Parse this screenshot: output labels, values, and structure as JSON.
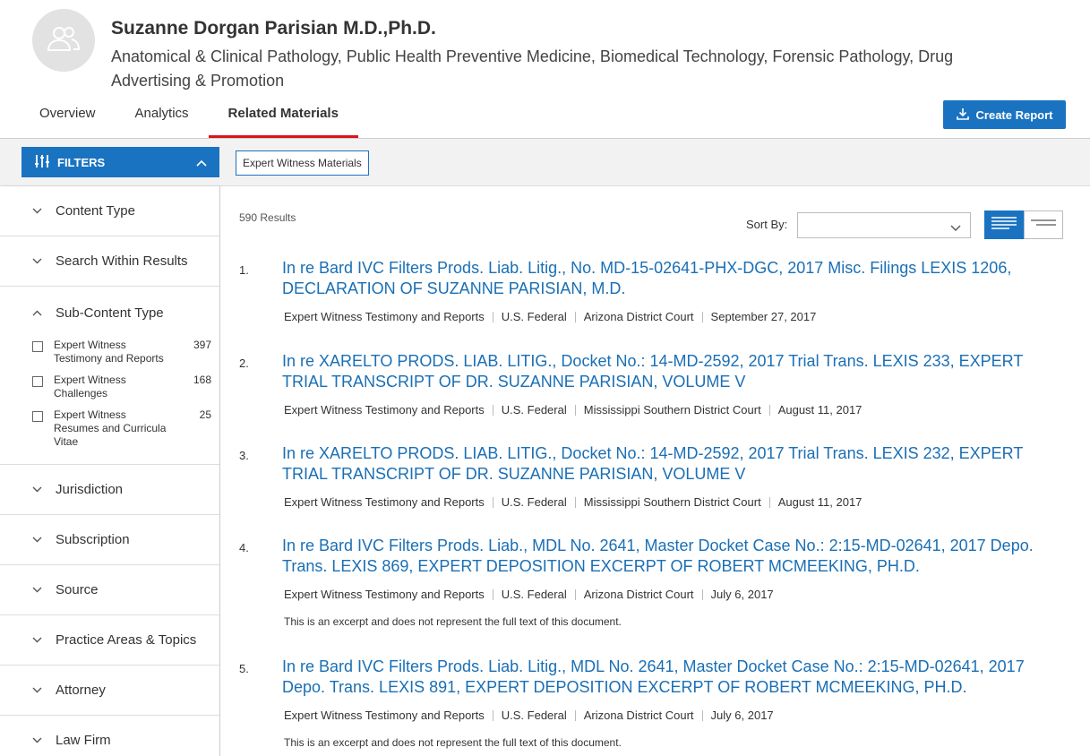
{
  "profile": {
    "name": "Suzanne Dorgan Parisian M.D.,Ph.D.",
    "specialties": "Anatomical & Clinical Pathology, Public Health Preventive Medicine, Biomedical Technology, Forensic Pathology, Drug Advertising & Promotion",
    "avatar_icon": "users-icon"
  },
  "tabs": [
    {
      "label": "Overview",
      "active": false
    },
    {
      "label": "Analytics",
      "active": false
    },
    {
      "label": "Related Materials",
      "active": true
    }
  ],
  "create_report": {
    "label": "Create Report",
    "icon": "download-icon"
  },
  "filterbar": {
    "filters_label": "FILTERS",
    "active_chip": "Expert Witness Materials"
  },
  "sidebar": {
    "facets_top": [
      "Content Type",
      "Search Within Results"
    ],
    "sub_content": {
      "label": "Sub-Content Type",
      "items": [
        {
          "label": "Expert Witness Testimony and Reports",
          "count": "397"
        },
        {
          "label": "Expert Witness Challenges",
          "count": "168"
        },
        {
          "label": "Expert Witness Resumes and Curricula Vitae",
          "count": "25"
        }
      ]
    },
    "facets_bottom": [
      "Jurisdiction",
      "Subscription",
      "Source",
      "Practice Areas & Topics",
      "Attorney",
      "Law Firm"
    ]
  },
  "results_header": {
    "count": "590 Results",
    "sort_label": "Sort By:",
    "sort_value": ""
  },
  "results": [
    {
      "num": "1.",
      "title": "In re Bard IVC Filters Prods. Liab. Litig., No. MD-15-02641-PHX-DGC, 2017 Misc. Filings LEXIS 1206, DECLARATION OF SUZANNE PARISIAN, M.D.",
      "type": "Expert Witness Testimony and Reports",
      "jurisdiction": "U.S. Federal",
      "court": "Arizona District Court",
      "date": "September 27, 2017",
      "note": ""
    },
    {
      "num": "2.",
      "title": "In re XARELTO PRODS. LIAB. LITIG., Docket No.: 14-MD-2592, 2017 Trial Trans. LEXIS 233, EXPERT TRIAL TRANSCRIPT OF DR. SUZANNE PARISIAN, VOLUME V",
      "type": "Expert Witness Testimony and Reports",
      "jurisdiction": "U.S. Federal",
      "court": "Mississippi Southern District Court",
      "date": "August 11, 2017",
      "note": ""
    },
    {
      "num": "3.",
      "title": "In re XARELTO PRODS. LIAB. LITIG., Docket No.: 14-MD-2592, 2017 Trial Trans. LEXIS 232, EXPERT TRIAL TRANSCRIPT OF DR. SUZANNE PARISIAN, VOLUME V",
      "type": "Expert Witness Testimony and Reports",
      "jurisdiction": "U.S. Federal",
      "court": "Mississippi Southern District Court",
      "date": "August 11, 2017",
      "note": ""
    },
    {
      "num": "4.",
      "title": "In re Bard IVC Filters Prods. Liab., MDL No. 2641, Master Docket Case No.: 2:15-MD-02641, 2017 Depo. Trans. LEXIS 869, EXPERT DEPOSITION EXCERPT OF ROBERT MCMEEKING, PH.D.",
      "type": "Expert Witness Testimony and Reports",
      "jurisdiction": "U.S. Federal",
      "court": "Arizona District Court",
      "date": "July 6, 2017",
      "note": "This is an excerpt and does not represent the full text of this document."
    },
    {
      "num": "5.",
      "title": "In re Bard IVC Filters Prods. Liab. Litig., MDL No. 2641, Master Docket Case No.: 2:15-MD-02641, 2017 Depo. Trans. LEXIS 891, EXPERT DEPOSITION EXCERPT OF ROBERT MCMEEKING, PH.D.",
      "type": "Expert Witness Testimony and Reports",
      "jurisdiction": "U.S. Federal",
      "court": "Arizona District Court",
      "date": "July 6, 2017",
      "note": "This is an excerpt and does not represent the full text of this document."
    }
  ],
  "colors": {
    "accent": "#1a73c1",
    "link": "#1a6fb5",
    "active_tab_underline": "#d9141b"
  }
}
